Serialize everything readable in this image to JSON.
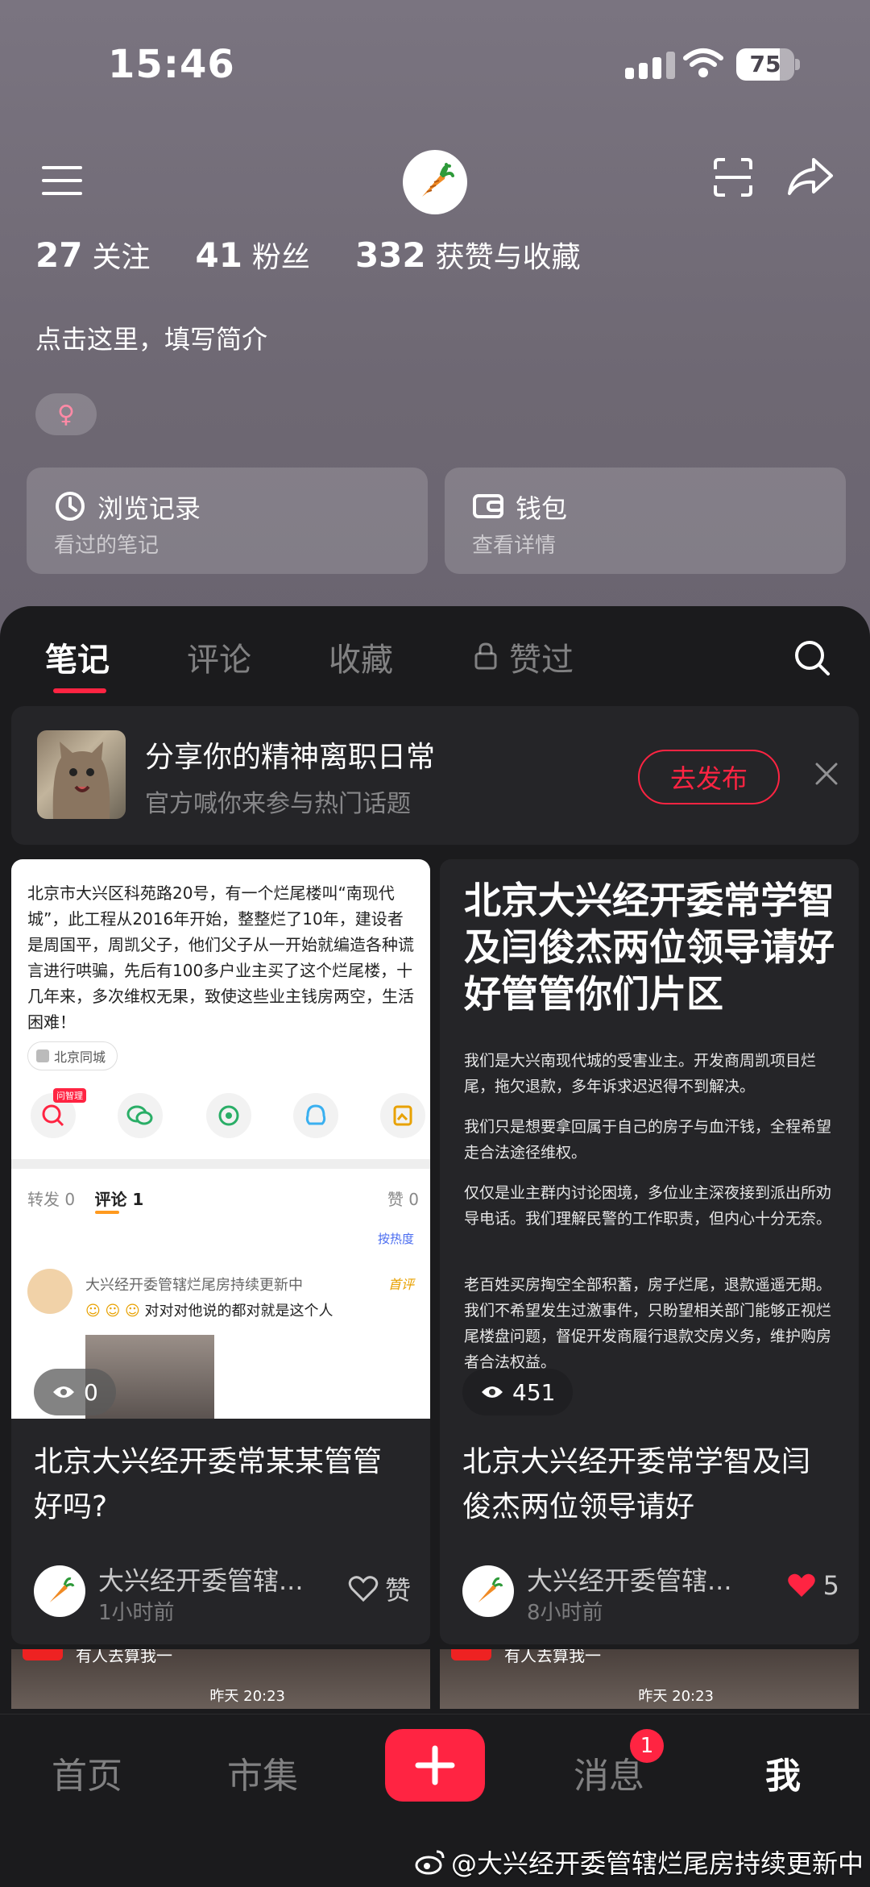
{
  "status_bar": {
    "time": "15:46",
    "battery": "75",
    "battery_level": 0.75
  },
  "profile": {
    "following_count": "27",
    "following_label": "关注",
    "followers_count": "41",
    "followers_label": "粉丝",
    "likes_count": "332",
    "likes_label": "获赞与收藏",
    "bio_placeholder": "点击这里，填写简介",
    "gender_symbol": "♀"
  },
  "quick_cards": [
    {
      "title": "浏览记录",
      "subtitle": "看过的笔记",
      "icon": "clock-icon"
    },
    {
      "title": "钱包",
      "subtitle": "查看详情",
      "icon": "wallet-icon"
    }
  ],
  "tabs": [
    {
      "label": "笔记"
    },
    {
      "label": "评论"
    },
    {
      "label": "收藏"
    },
    {
      "label": "赞过",
      "icon": "lock-icon"
    }
  ],
  "banner": {
    "title": "分享你的精神离职日常",
    "subtitle": "官方喊你来参与热门话题",
    "button": "去发布"
  },
  "notes": [
    {
      "cover_text": "北京市大兴区科苑路20号，有一个烂尾楼叫“南现代城”，此工程从2016年开始，整整烂了10年，建设者是周国平，周凯父子，他们父子从一开始就编造各种谎言进行哄骗，先后有100多户业主买了这个烂尾楼，十几年来，多次维权无果，致使这些业主钱房两空，生活困难！",
      "cover_location": "北京同城",
      "cover_repost": "转发 0",
      "cover_comments": "评论 1",
      "cover_likes": "赞 0",
      "cover_sort": "按热度",
      "cover_commenter": "大兴经开委管辖烂尾房持续更新中",
      "cover_comment": "对对对他说的都对就是这个人",
      "cover_first": "首评",
      "cover_ai_badge": "问智理",
      "views": "0",
      "caption": "北京大兴经开委常某某管管好吗?",
      "author": "大兴经开委管辖...",
      "time": "1小时前",
      "like_label": "赞"
    },
    {
      "cover_title": "北京大兴经开委常学智及闫俊杰两位领导请好好管管你们片区",
      "cover_paragraphs": [
        "我们是大兴南现代城的受害业主。开发商周凯项目烂尾，拖欠退款，多年诉求迟迟得不到解决。",
        "我们只是想要拿回属于自己的房子与血汗钱，全程希望走合法途径维权。",
        "仅仅是业主群内讨论困境，多位业主深夜接到派出所劝导电话。我们理解民警的工作职责，但内心十分无奈。",
        "老百姓买房掏空全部积蓄，房子烂尾，退款遥遥无期。我们不希望发生过激事件，只盼望相关部门能够正视烂尾楼盘问题，督促开发商履行退款交房义务，维护购房者合法权益。"
      ],
      "views": "451",
      "caption": "北京大兴经开委常学智及闫俊杰两位领导请好",
      "author": "大兴经开委管辖...",
      "time": "8小时前",
      "likes": "5"
    }
  ],
  "peek_cards": [
    {
      "text": "有人去算我一",
      "date": "昨天 20:23"
    },
    {
      "text": "有人去算我一",
      "date": "昨天 20:23"
    }
  ],
  "bottom_nav": {
    "home": "首页",
    "market": "市集",
    "messages": "消息",
    "messages_badge": "1",
    "me": "我"
  },
  "watermark": "@大兴经开委管辖烂尾房持续更新中",
  "colors": {
    "accent": "#ff2442",
    "profile_bg": "#746e7a",
    "content_bg": "#1b1b1d"
  }
}
